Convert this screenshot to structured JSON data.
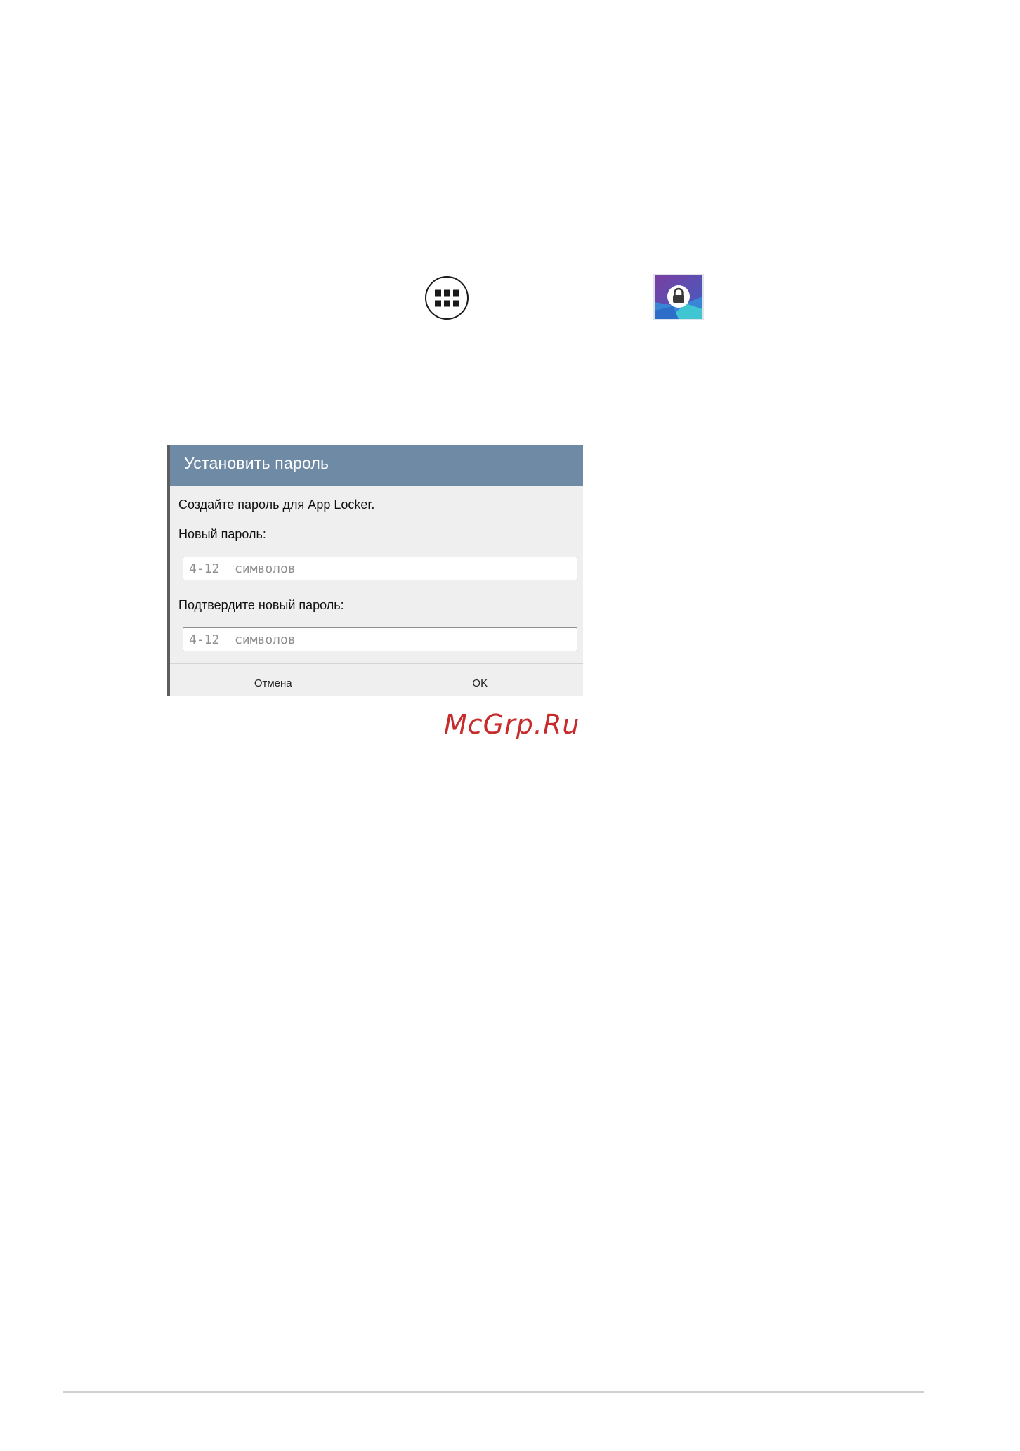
{
  "icons": {
    "all_apps": "apps-grid-icon",
    "app_locker": "app-locker-icon"
  },
  "dialog": {
    "title": "Установить пароль",
    "message": "Создайте пароль для App Locker.",
    "new_password_label": "Новый пароль:",
    "new_password_placeholder": "4-12  символов",
    "new_password_value": "",
    "confirm_password_label": "Подтвердите новый пароль:",
    "confirm_password_placeholder": "4-12  символов",
    "confirm_password_value": "",
    "cancel_label": "Отмена",
    "ok_label": "OK"
  },
  "watermark": "McGrp.Ru",
  "colors": {
    "dialog_header": "#6f8aa4",
    "dialog_body": "#efefef",
    "input_focus_border": "#5aa7c8",
    "watermark": "#c62c2c"
  }
}
